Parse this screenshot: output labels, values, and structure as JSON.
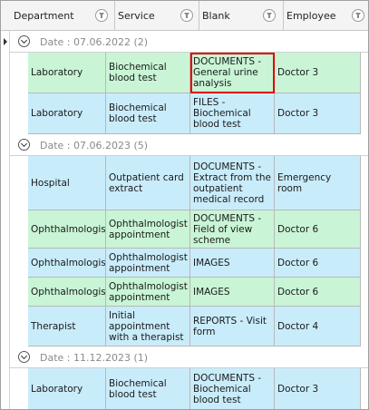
{
  "columns": [
    {
      "label": "Department"
    },
    {
      "label": "Service"
    },
    {
      "label": "Blank"
    },
    {
      "label": "Employee"
    }
  ],
  "groups": [
    {
      "label": "Date : 07.06.2022 (2)",
      "rows": [
        {
          "department": "Laboratory",
          "service": "Biochemical blood test",
          "blank": "DOCUMENTS - General urine analysis",
          "employee": "Doctor 3",
          "color": "green",
          "selected_cell": "blank",
          "current": true
        },
        {
          "department": "Laboratory",
          "service": "Biochemical blood test",
          "blank": "FILES - Biochemical blood test",
          "employee": "Doctor 3",
          "color": "blue"
        }
      ]
    },
    {
      "label": "Date : 07.06.2023 (5)",
      "rows": [
        {
          "department": "Hospital",
          "service": "Outpatient card extract",
          "blank": "DOCUMENTS - Extract from the outpatient medical record",
          "employee": "Emergency room",
          "color": "blue"
        },
        {
          "department": "Ophthalmologist",
          "service": "Ophthalmologist appointment",
          "blank": "DOCUMENTS - Field of view scheme",
          "employee": "Doctor 6",
          "color": "green"
        },
        {
          "department": "Ophthalmologist",
          "service": "Ophthalmologist appointment",
          "blank": "IMAGES",
          "employee": "Doctor 6",
          "color": "blue"
        },
        {
          "department": "Ophthalmologist",
          "service": "Ophthalmologist appointment",
          "blank": "IMAGES",
          "employee": "Doctor 6",
          "color": "green"
        },
        {
          "department": "Therapist",
          "service": "Initial appointment with a therapist",
          "blank": "REPORTS - Visit form",
          "employee": "Doctor 4",
          "color": "blue"
        }
      ]
    },
    {
      "label": "Date : 11.12.2023 (1)",
      "rows": [
        {
          "department": "Laboratory",
          "service": "Biochemical blood test",
          "blank": "DOCUMENTS - Biochemical blood test",
          "employee": "Doctor 3",
          "color": "blue"
        }
      ]
    }
  ],
  "colors": {
    "green_row": "#c9f5d6",
    "blue_row": "#c9ecfb",
    "selection_border": "#e00000"
  }
}
